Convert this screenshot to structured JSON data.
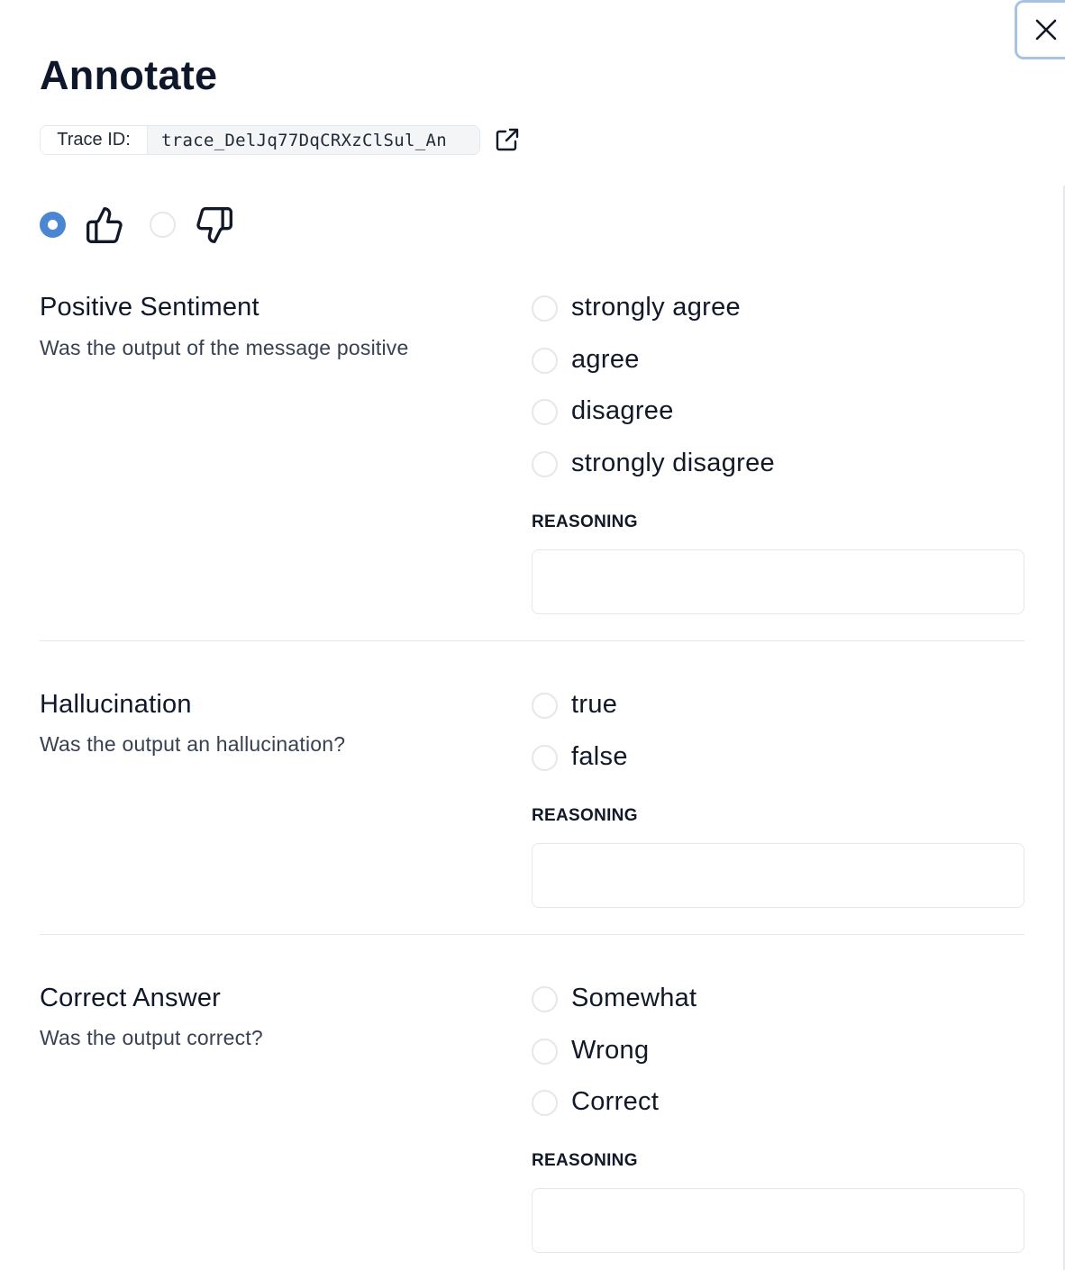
{
  "dialog": {
    "title": "Annotate"
  },
  "trace": {
    "label": "Trace ID:",
    "value": "trace_DelJq77DqCRXzClSul_An"
  },
  "feedback": {
    "selected": "thumbs-up"
  },
  "sections": [
    {
      "title": "Positive Sentiment",
      "description": "Was the output of the message positive",
      "options": [
        "strongly agree",
        "agree",
        "disagree",
        "strongly disagree"
      ],
      "reasoning_label": "REASONING",
      "reasoning_value": ""
    },
    {
      "title": "Hallucination",
      "description": "Was the output an hallucination?",
      "options": [
        "true",
        "false"
      ],
      "reasoning_label": "REASONING",
      "reasoning_value": ""
    },
    {
      "title": "Correct Answer",
      "description": "Was the output correct?",
      "options": [
        "Somewhat",
        "Wrong",
        "Correct"
      ],
      "reasoning_label": "REASONING",
      "reasoning_value": ""
    }
  ],
  "icons": {
    "close": "close-icon",
    "external_link": "external-link-icon",
    "thumbs_up": "thumbs-up-icon",
    "thumbs_down": "thumbs-down-icon"
  },
  "colors": {
    "accent": "#4b86d2",
    "border": "#e5e7eb",
    "text": "#0f172a"
  }
}
